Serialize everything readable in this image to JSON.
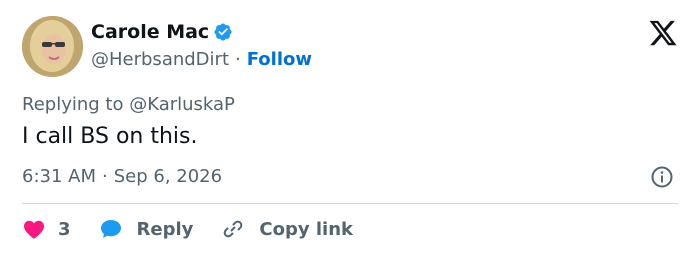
{
  "author": {
    "name": "Carole Mac",
    "handle": "@HerbsandDirt",
    "separator": "·",
    "follow_label": "Follow"
  },
  "tweet": {
    "replying_to": "Replying to @KarluskaP",
    "text": "I call BS on this.",
    "time": "6:31 AM",
    "date_separator": "·",
    "date": "Sep 6, 2026"
  },
  "actions": {
    "like_count": "3",
    "reply_label": "Reply",
    "copy_link_label": "Copy link"
  },
  "colors": {
    "verified": "#1d9bf0",
    "follow": "#006fd6",
    "like": "#f91880",
    "reply_icon": "#1d9bf0",
    "muted": "#536471"
  },
  "icons": {
    "verified": "verified-badge-icon",
    "logo": "x-logo-icon",
    "info": "info-icon",
    "like": "heart-icon",
    "reply": "speech-bubble-icon",
    "copy": "link-icon"
  }
}
